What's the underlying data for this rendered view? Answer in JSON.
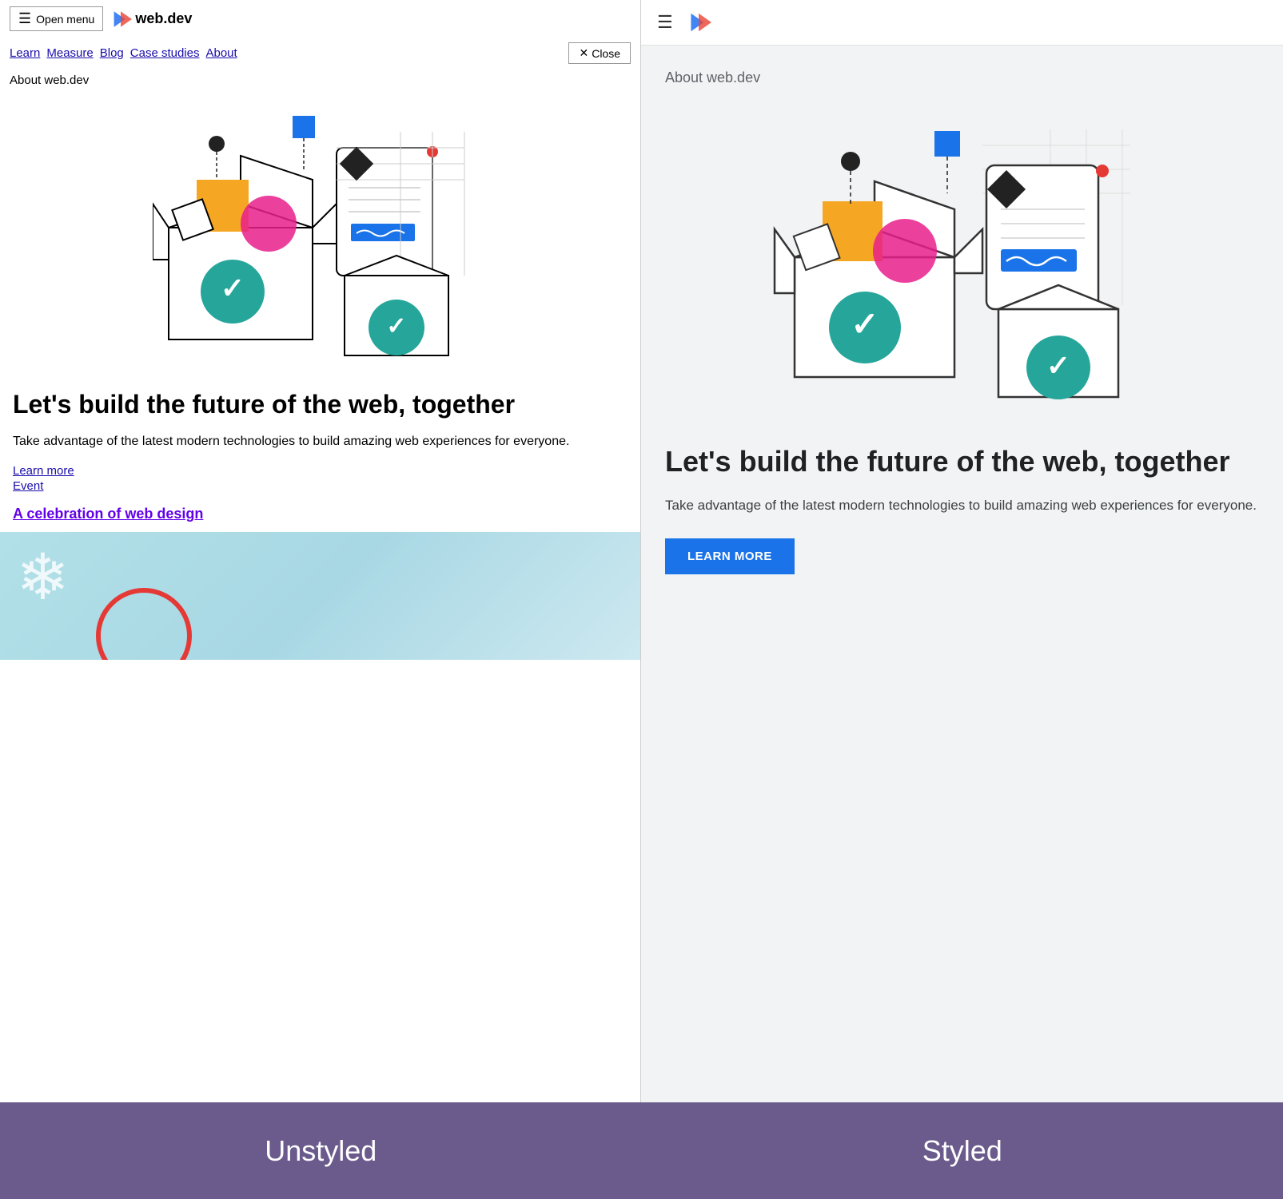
{
  "site": {
    "name": "web.dev",
    "tagline": "About web.dev"
  },
  "left_panel": {
    "menu_button": "Open menu",
    "close_button": "Close",
    "nav_links": [
      "Learn",
      "Measure",
      "Blog",
      "Case studies",
      "About"
    ],
    "about_text": "About web.dev",
    "heading": "Let's build the future of the web, together",
    "description": "Take advantage of the latest modern technologies to build amazing web experiences for everyone.",
    "link_learn_more": "Learn more",
    "link_event": "Event",
    "event_link_text": "A celebration of web design"
  },
  "right_panel": {
    "about_text": "About web.dev",
    "heading": "Let's build the future of the web, together",
    "description": "Take advantage of the latest modern technologies to build amazing web experiences for everyone.",
    "learn_more_button": "LEARN MORE"
  },
  "labels": {
    "unstyled": "Unstyled",
    "styled": "Styled"
  },
  "colors": {
    "accent_blue": "#1a73e8",
    "accent_purple": "#6b5b8c",
    "teal_check": "#26a69a",
    "orange": "#f5a623",
    "pink": "#e91e8c"
  }
}
